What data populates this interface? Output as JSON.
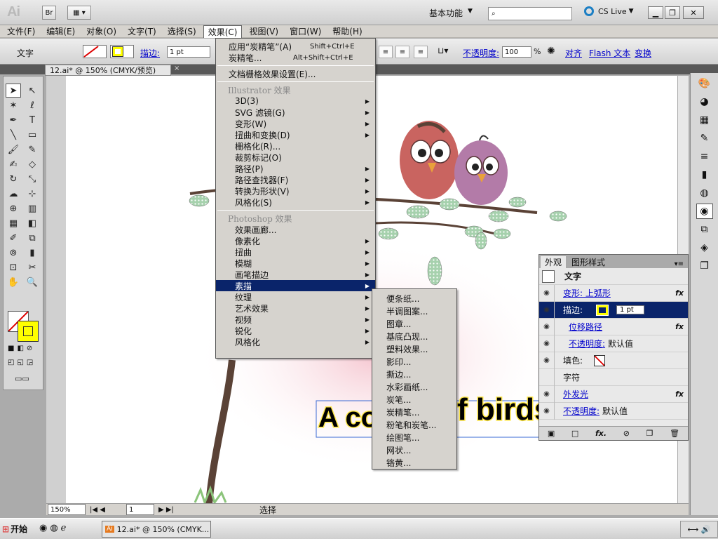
{
  "app": {
    "logo": "Ai",
    "bridge_btn": "Br",
    "workspace": "基本功能",
    "search_placeholder": "",
    "cs_live": "CS Live"
  },
  "menubar": [
    "文件(F)",
    "编辑(E)",
    "对象(O)",
    "文字(T)",
    "选择(S)",
    "效果(C)",
    "视图(V)",
    "窗口(W)",
    "帮助(H)"
  ],
  "control": {
    "tool_label": "文字",
    "stroke_label": "描边:",
    "stroke_value": "1 pt",
    "opacity_label": "不透明度:",
    "opacity_value": "100",
    "opacity_unit": "%",
    "align_link": "对齐",
    "flash_link": "Flash 文本",
    "transform_link": "变换"
  },
  "document": {
    "tab_title": "12.ai* @ 150% (CMYK/预览)",
    "close": "×"
  },
  "effect_menu": {
    "top_items": [
      {
        "label": "应用“炭精笔”(A)",
        "shortcut": "Shift+Ctrl+E"
      },
      {
        "label": "炭精笔...",
        "shortcut": "Alt+Shift+Ctrl+E"
      }
    ],
    "raster_settings": "文档栅格效果设置(E)...",
    "illustrator_header": "Illustrator 效果",
    "illustrator_items": [
      {
        "label": "3D(3)",
        "sub": true
      },
      {
        "label": "SVG 滤镜(G)",
        "sub": true
      },
      {
        "label": "变形(W)",
        "sub": true
      },
      {
        "label": "扭曲和变换(D)",
        "sub": true
      },
      {
        "label": "栅格化(R)...",
        "sub": false
      },
      {
        "label": "裁剪标记(O)",
        "sub": false
      },
      {
        "label": "路径(P)",
        "sub": true
      },
      {
        "label": "路径查找器(F)",
        "sub": true
      },
      {
        "label": "转换为形状(V)",
        "sub": true
      },
      {
        "label": "风格化(S)",
        "sub": true
      }
    ],
    "photoshop_header": "Photoshop 效果",
    "photoshop_items": [
      {
        "label": "效果画廊...",
        "sub": false
      },
      {
        "label": "像素化",
        "sub": true
      },
      {
        "label": "扭曲",
        "sub": true
      },
      {
        "label": "模糊",
        "sub": true
      },
      {
        "label": "画笔描边",
        "sub": true
      },
      {
        "label": "素描",
        "sub": true,
        "highlighted": true
      },
      {
        "label": "纹理",
        "sub": true
      },
      {
        "label": "艺术效果",
        "sub": true
      },
      {
        "label": "视频",
        "sub": true
      },
      {
        "label": "锐化",
        "sub": true
      },
      {
        "label": "风格化",
        "sub": true
      }
    ]
  },
  "sketch_submenu": [
    "便条纸...",
    "半调图案...",
    "图章...",
    "基底凸现...",
    "塑料效果...",
    "影印...",
    "撕边...",
    "水彩画纸...",
    "炭笔...",
    "炭精笔...",
    "粉笔和炭笔...",
    "绘图笔...",
    "网状...",
    "铬黄..."
  ],
  "appearance": {
    "tabs": [
      "外观",
      "图形样式"
    ],
    "title": "文字",
    "rows": [
      {
        "label": "变形: 上弧形",
        "link": true,
        "fx": "fx"
      },
      {
        "label": "描边:",
        "link": false,
        "selected": true,
        "value": "1 pt"
      },
      {
        "label": "位移路径",
        "link": true,
        "fx": "fx",
        "indent": true
      },
      {
        "label": "不透明度:",
        "suffix": "默认值",
        "link": true,
        "indent": true
      },
      {
        "label": "填色:",
        "link": false
      },
      {
        "label": "字符",
        "link": false
      },
      {
        "label": "外发光",
        "link": true,
        "fx": "fx"
      },
      {
        "label": "不透明度:",
        "suffix": "默认值",
        "link": true
      }
    ]
  },
  "artwork": {
    "text": "A co",
    "text2": "f birds"
  },
  "status": {
    "zoom": "150%",
    "page": "1",
    "tool": "选择"
  },
  "taskbar": {
    "start": "开始",
    "item": "12.ai* @ 150% (CMYK..."
  },
  "colors": {
    "accent": "#0a246a",
    "link": "#0000cc",
    "fill_yellow": "#ffff00"
  }
}
